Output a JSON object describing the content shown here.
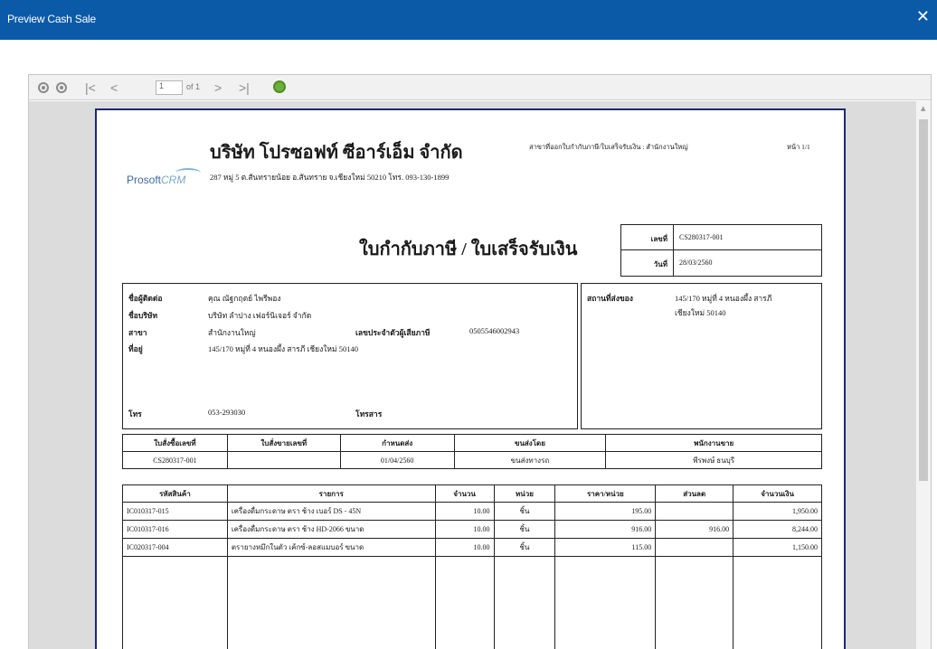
{
  "window": {
    "title": "Preview Cash Sale",
    "close_glyph": "✕"
  },
  "toolbar": {
    "first_glyph": "|<",
    "prev_glyph": "<",
    "next_glyph": ">",
    "last_glyph": ">|",
    "page_value": "1",
    "page_of": "of 1"
  },
  "doc": {
    "company_name": "บริษัท โปรซอฟท์ ซีอาร์เอ็ม จำกัด",
    "address": "287 หมู่ 5 ต.สันทรายน้อย อ.สันทราย จ.เชียงใหม่ 50210 โทร. 093-130-1899",
    "logo_main": "Prosoft",
    "logo_sub": "CRM",
    "note": "สาขาที่ออกใบกำกับภาษี/ใบเสร็จรับเงิน : สำนักงานใหญ่",
    "page_label": "หน้า 1/1",
    "title": "ใบกำกับภาษี / ใบเสร็จรับเงิน",
    "doc_no_label": "เลขที่",
    "doc_no": "CS280317-001",
    "date_label": "วันที่",
    "date": "28/03/2560"
  },
  "customer": {
    "contact_label": "ชื่อผู้ติดต่อ",
    "contact": "คุณ ณัฐกฤตย์ ไพรีพอง",
    "company_label": "ชื่อบริษัท",
    "company": "บริษัท ลำปาง เฟอร์นิเจอร์ จำกัด",
    "branch_label": "สาขา",
    "branch": "สำนักงานใหญ่",
    "taxid_label": "เลขประจำตัวผู้เสียภาษี",
    "taxid": "0505546002943",
    "address_label": "ที่อยู่",
    "address": "145/170 หมู่ที่ 4 หนองผึ้ง สารภี เชียงใหม่ 50140",
    "phone_label": "โทร",
    "phone": "053-293030",
    "fax_label": "โทรสาร"
  },
  "shipping": {
    "label": "สถานที่ส่งของ",
    "address_line1": "145/170 หมู่ที่ 4 หนองผึ้ง สารภี",
    "address_line2": "เชียงใหม่ 50140"
  },
  "ref_table": {
    "headers": [
      "ใบสั่งซื้อเลขที่",
      "ใบสั่งขายเลขที่",
      "กำหนดส่ง",
      "ขนส่งโดย",
      "พนักงานขาย"
    ],
    "row": [
      "CS280317-001",
      "",
      "01/04/2560",
      "ขนส่งทางรถ",
      "พีรพงษ์ ธนบุรี"
    ]
  },
  "item_table": {
    "headers": [
      "รหัสสินค้า",
      "รายการ",
      "จำนวน",
      "หน่วย",
      "ราคา/หน่วย",
      "ส่วนลด",
      "จำนวนเงิน"
    ],
    "rows": [
      [
        "IC010317-015",
        "เครื่องดื่มกระดาษ ตรา ช้าง เบอร์ DS - 45N",
        "10.00",
        "ชิ้น",
        "195.00",
        "",
        "1,950.00"
      ],
      [
        "IC010317-016",
        "เครื่องดื่มกระดาษ ตรา ช้าง HD-2066 ขนาด",
        "10.00",
        "ชิ้น",
        "916.00",
        "916.00",
        "8,244.00"
      ],
      [
        "IC020317-004",
        "ตรายางหมึกในตัว เค้กซ์-ลอสแมบอร์ ขนาด",
        "10.00",
        "ชิ้น",
        "115.00",
        "",
        "1,150.00"
      ]
    ]
  }
}
